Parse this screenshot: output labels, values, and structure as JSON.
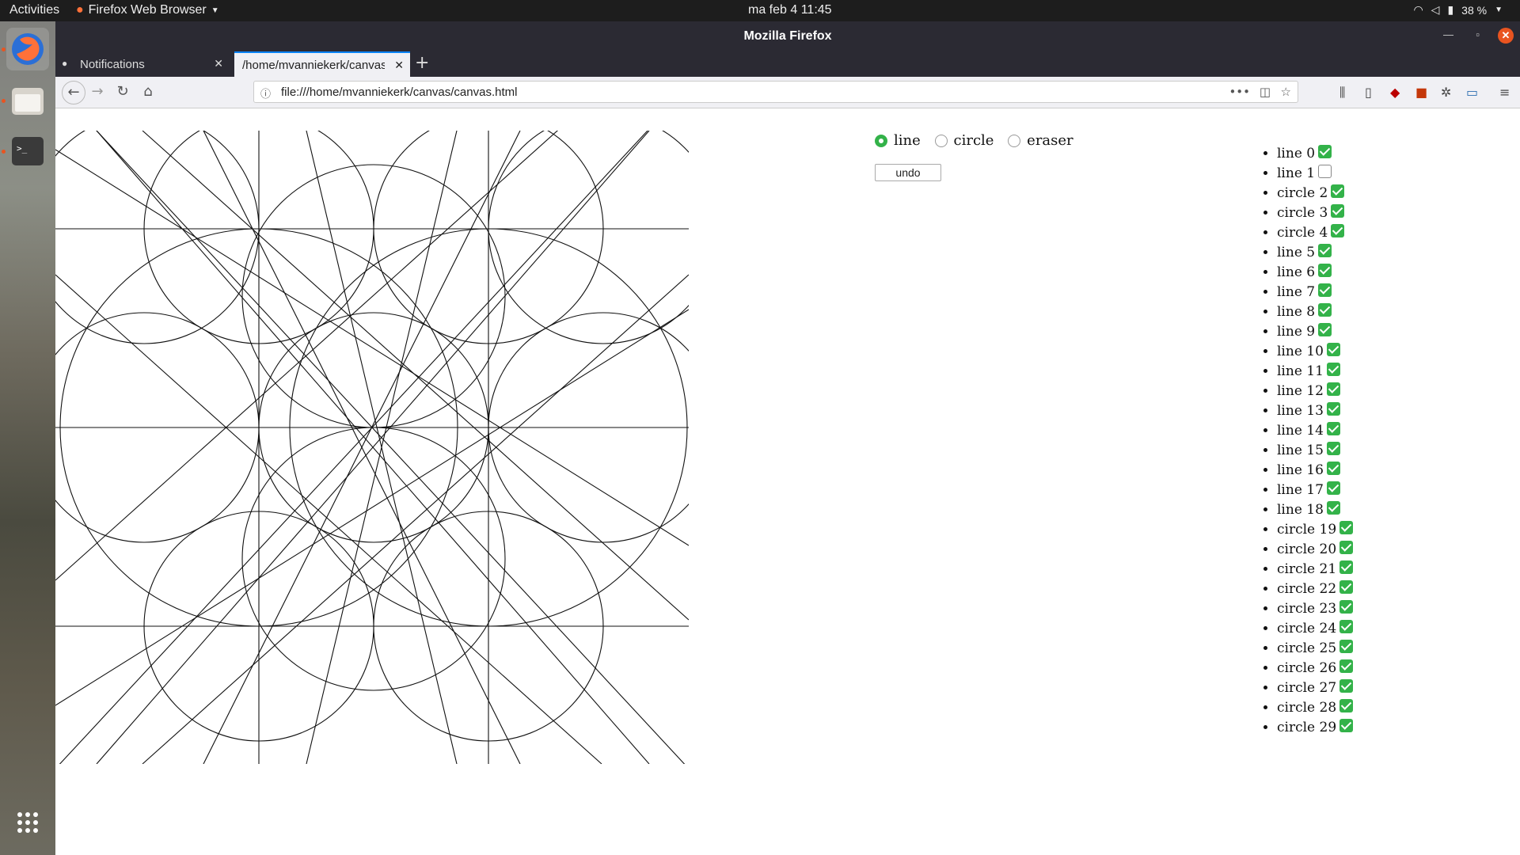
{
  "topbar": {
    "activities": "Activities",
    "app_name": "Firefox Web Browser",
    "clock": "ma feb 4  11:45",
    "battery": "38 %"
  },
  "window": {
    "title": "Mozilla Firefox"
  },
  "tabs": [
    {
      "label": "Notifications",
      "active": false
    },
    {
      "label": "/home/mvanniekerk/canvas",
      "active": true
    }
  ],
  "navbar": {
    "url": "file:///home/mvanniekerk/canvas/canvas.html"
  },
  "controls": {
    "tools": [
      {
        "label": "line",
        "selected": true
      },
      {
        "label": "circle",
        "selected": false
      },
      {
        "label": "eraser",
        "selected": false
      }
    ],
    "undo_label": "undo"
  },
  "shapes": [
    {
      "label": "line 0",
      "checked": true
    },
    {
      "label": "line 1",
      "checked": false
    },
    {
      "label": "circle 2",
      "checked": true
    },
    {
      "label": "circle 3",
      "checked": true
    },
    {
      "label": "circle 4",
      "checked": true
    },
    {
      "label": "line 5",
      "checked": true
    },
    {
      "label": "line 6",
      "checked": true
    },
    {
      "label": "line 7",
      "checked": true
    },
    {
      "label": "line 8",
      "checked": true
    },
    {
      "label": "line 9",
      "checked": true
    },
    {
      "label": "line 10",
      "checked": true
    },
    {
      "label": "line 11",
      "checked": true
    },
    {
      "label": "line 12",
      "checked": true
    },
    {
      "label": "line 13",
      "checked": true
    },
    {
      "label": "line 14",
      "checked": true
    },
    {
      "label": "line 15",
      "checked": true
    },
    {
      "label": "line 16",
      "checked": true
    },
    {
      "label": "line 17",
      "checked": true
    },
    {
      "label": "line 18",
      "checked": true
    },
    {
      "label": "circle 19",
      "checked": true
    },
    {
      "label": "circle 20",
      "checked": true
    },
    {
      "label": "circle 21",
      "checked": true
    },
    {
      "label": "circle 22",
      "checked": true
    },
    {
      "label": "circle 23",
      "checked": true
    },
    {
      "label": "circle 24",
      "checked": true
    },
    {
      "label": "circle 25",
      "checked": true
    },
    {
      "label": "circle 26",
      "checked": true
    },
    {
      "label": "circle 27",
      "checked": true
    },
    {
      "label": "circle 28",
      "checked": true
    },
    {
      "label": "circle 29",
      "checked": true
    }
  ]
}
